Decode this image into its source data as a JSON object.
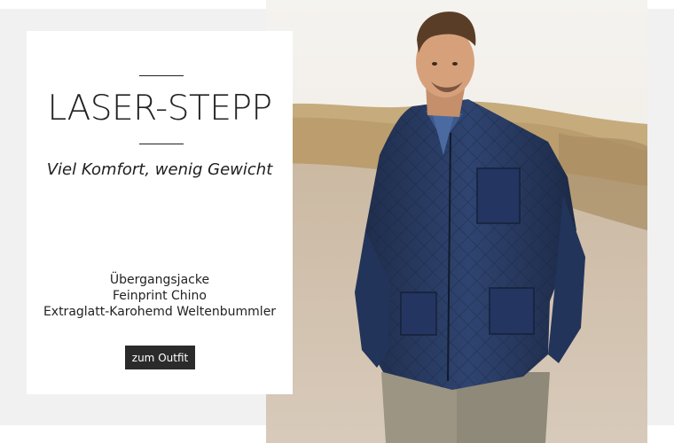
{
  "teaser": {
    "headline": "LASER-STEPP",
    "subline": "Viel Komfort, wenig Gewicht",
    "items": [
      "Übergangsjacke",
      "Feinprint Chino",
      "Extraglatt-Karohemd Weltenbummler"
    ],
    "cta_label": "zum Outfit"
  },
  "colors": {
    "background": "#f1f1f1",
    "card": "#ffffff",
    "button": "#2b2b2b",
    "jacket": "#27385a"
  },
  "photo": {
    "subject": "man-in-quilted-jacket-on-dunes"
  }
}
